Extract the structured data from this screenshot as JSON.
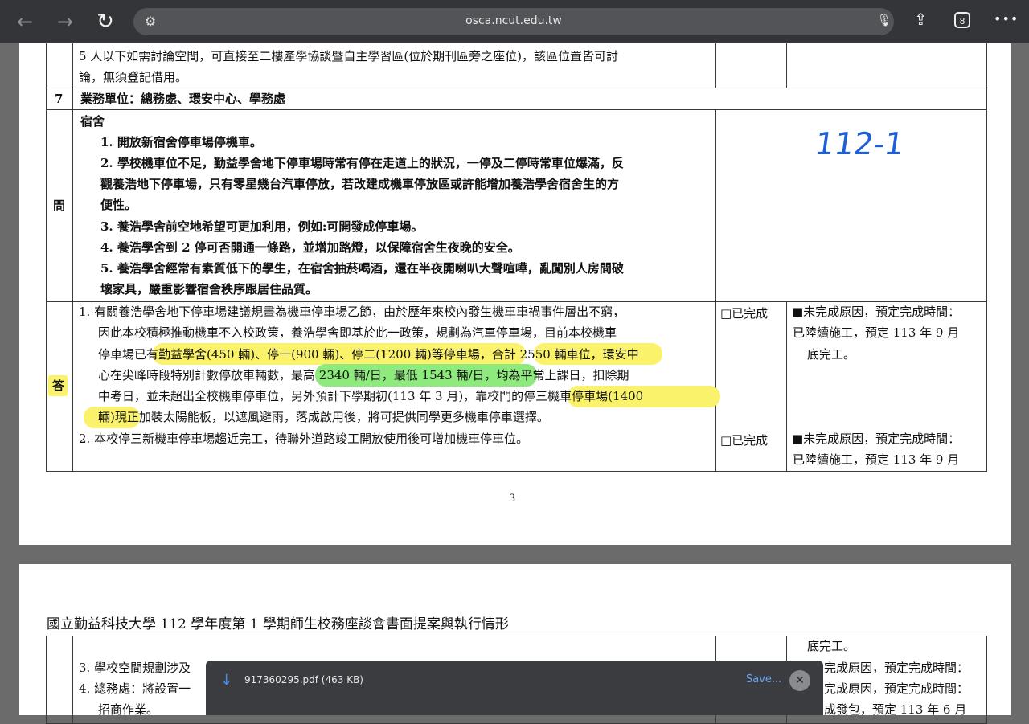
{
  "browser": {
    "url": "osca.ncut.edu.tw",
    "tab_count": "8",
    "icons": {
      "back": "←",
      "forward": "→",
      "reload": "↻",
      "site_settings": "⚙",
      "mic": "🎙",
      "share": "⇪",
      "more": "•••"
    }
  },
  "page1": {
    "row_top": {
      "line1": "5 人以下如需討論空間，可直接至二樓產學協談暨自主學習區(位於期刊區旁之座位)，該區位置皆可討",
      "line2": "論，無須登記借用。"
    },
    "row7": {
      "num": "7",
      "unit": "業務單位：總務處、環安中心、學務處"
    },
    "question": {
      "label": "問",
      "handwriting": "112-1",
      "title": "宿舍",
      "lines": [
        "1. 開放新宿舍停車場停機車。",
        "2. 學校機車位不足，勤益學舍地下停車場時常有停在走道上的狀況，一停及二停時常車位爆滿，反",
        "觀養浩地下停車場，只有零星幾台汽車停放，若改建成機車停放區或許能增加養浩學舍宿舍生的方",
        "便性。",
        "3. 養浩學舍前空地希望可更加利用，例如:可開發成停車場。",
        "4. 養浩學舍到 2 停可否開通一條路，並增加路燈，以保障宿舍生夜晚的安全。",
        "5. 養浩學舍經常有素質低下的學生，在宿舍抽菸喝酒，還在半夜開喇叭大聲喧嘩，亂闖別人房間破",
        "壞家具，嚴重影響宿舍秩序跟居住品質。"
      ]
    },
    "answer": {
      "label": "答",
      "lines": [
        "1. 有關養浩學舍地下停車場建議規畫為機車停車場乙節，由於歷年來校內發生機車車禍事件層出不窮，",
        "因此本校積極推動機車不入校政策，養浩學舍即基於此一政策，規劃為汽車停車場，目前本校機車",
        "停車場已有勤益學舍(450 輛)、停一(900 輛)、停二(1200 輛)等停車場，合計 2550 輛車位，環安中",
        "心在尖峰時段特別計數停放車輛數，最高 2340 輛/日，最低 1543 輛/日，均為平常上課日，扣除期",
        "中考日，並未超出全校機車停車位，另外預計下學期初(113 年 3 月)，靠校門的停三機車停車場(1400",
        "輛)現正加裝太陽能板，以遮風避雨，落成啟用後，將可提供同學更多機車停車選擇。",
        "2. 本校停三新機車停車場趨近完工，待聯外道路竣工開放使用後可增加機車停車位。"
      ],
      "status1": "□已完成",
      "status2": "□已完成",
      "reason1": [
        "■未完成原因，預定完成時間：",
        "已陸續施工，預定 113 年 9 月",
        "底完工。"
      ],
      "reason2": [
        "■未完成原因，預定完成時間：",
        "已陸續施工，預定 113 年 9 月"
      ]
    },
    "page_number": "3"
  },
  "page2": {
    "title": "國立勤益科技大學 112 學年度第 1 學期師生校務座談會書面提案與執行情形",
    "lines": [
      "3. 學校空間規劃涉及",
      "4. 總務處：將設置一",
      "招商作業。"
    ],
    "right_lines": [
      "底完工。",
      "完成原因，預定完成時間：",
      "完成原因，預定完成時間：",
      "成發包，預定 113 年 6 月"
    ]
  },
  "download": {
    "filename": "917360295.pdf (463 KB)",
    "save_label": "Save...",
    "icons": {
      "download": "↓",
      "close": "✕"
    }
  }
}
